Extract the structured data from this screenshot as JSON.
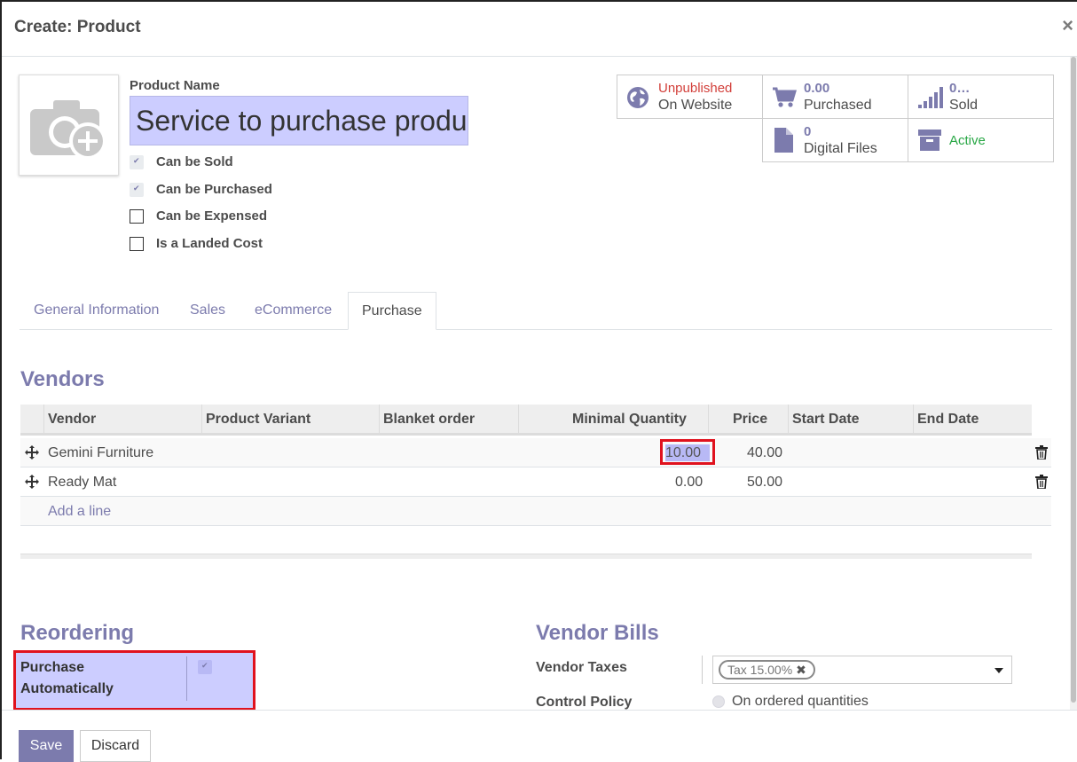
{
  "modal": {
    "title": "Create: Product",
    "close": "×"
  },
  "product": {
    "name_label": "Product Name",
    "name_value": "Service to purchase produ",
    "checkboxes": [
      {
        "label": "Can be Sold",
        "checked": true
      },
      {
        "label": "Can be Purchased",
        "checked": true
      },
      {
        "label": "Can be Expensed",
        "checked": false
      },
      {
        "label": "Is a Landed Cost",
        "checked": false
      }
    ]
  },
  "stats": {
    "website": {
      "top": "Unpublished",
      "bottom": "On Website",
      "top_color": "#d23f3a"
    },
    "purchased": {
      "top": "0.00",
      "bottom": "Purchased"
    },
    "sold": {
      "top": "0…",
      "bottom": "Sold"
    },
    "files": {
      "top": "0",
      "bottom": "Digital Files"
    },
    "active": {
      "top": "Active",
      "top_color": "#28a745"
    }
  },
  "tabs": [
    {
      "label": "General Information",
      "active": false
    },
    {
      "label": "Sales",
      "active": false
    },
    {
      "label": "eCommerce",
      "active": false
    },
    {
      "label": "Purchase",
      "active": true
    }
  ],
  "vendors": {
    "title": "Vendors",
    "columns": [
      "Vendor",
      "Product Variant",
      "Blanket order",
      "Minimal Quantity",
      "Price",
      "Start Date",
      "End Date"
    ],
    "rows": [
      {
        "vendor": "Gemini Furniture",
        "variant": "",
        "blanket": "",
        "min_qty": "10.00",
        "price": "40.00",
        "start": "",
        "end": ""
      },
      {
        "vendor": "Ready Mat",
        "variant": "",
        "blanket": "",
        "min_qty": "0.00",
        "price": "50.00",
        "start": "",
        "end": ""
      }
    ],
    "add_line": "Add a line"
  },
  "reordering": {
    "title": "Reordering",
    "purchase_auto_label": "Purchase Automatically",
    "purchase_auto_checked": true
  },
  "vendor_bills": {
    "title": "Vendor Bills",
    "taxes_label": "Vendor Taxes",
    "tax_tag": "Tax 15.00%",
    "control_label": "Control Policy",
    "control_option": "On ordered quantities"
  },
  "footer": {
    "save": "Save",
    "discard": "Discard"
  },
  "colors": {
    "primary": "#7c7bad",
    "highlight": "#cccdff",
    "annotation": "#e0121e"
  }
}
